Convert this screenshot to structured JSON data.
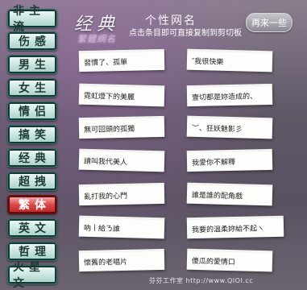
{
  "sidebar": {
    "items": [
      {
        "label": "非主流"
      },
      {
        "label": "伤感"
      },
      {
        "label": "男生"
      },
      {
        "label": "女生"
      },
      {
        "label": "情侣"
      },
      {
        "label": "搞笑"
      },
      {
        "label": "经典"
      },
      {
        "label": "超拽"
      },
      {
        "label": "繁体",
        "active": true
      },
      {
        "label": "英文"
      },
      {
        "label": "哲理"
      },
      {
        "label": "火星文"
      }
    ]
  },
  "header": {
    "title": "经典",
    "subtitle": "个性网名",
    "hint": "点击条目即可直接复制到剪切板",
    "logo_text": "繁體網名",
    "refresh_label": "再来一些"
  },
  "names": [
    "習慣了、孤單",
    "″我很快樂",
    "霓虹燈下的美麗",
    "壹切都是妳造成的、",
    "無可回頭的孤獨",
    "︶、狂妖魅影彡",
    "請叫我代美人",
    "我愛你不解釋",
    "亂打我的心門",
    "誰是誰的配角戲",
    "吶丨給ㄋ誰",
    "我要的溫柔妳給不起ヽ",
    "懷舊的老唱片",
    "傻瓜的愛情口"
  ],
  "footer": {
    "text": "芬芬工作室 http://www.QIOI.cc"
  },
  "colors": {
    "background": "#6a6270",
    "sidebar_button": "#cfe8e2",
    "sidebar_button_active": "#d94a4a",
    "note": "#fdfdfb"
  }
}
